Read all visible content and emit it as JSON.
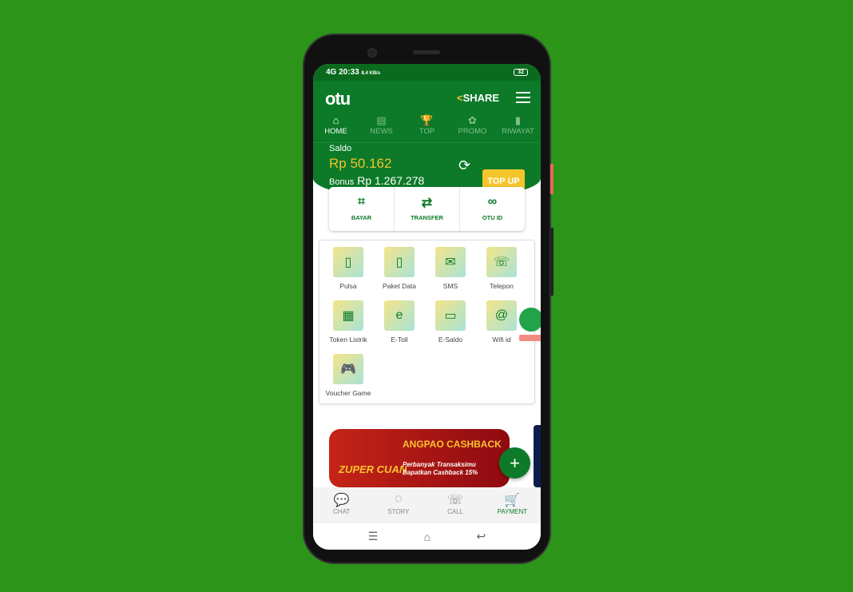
{
  "status": {
    "signal": "4G",
    "time": "20:33",
    "speed": "8.4 KB/s",
    "battery": "32"
  },
  "header": {
    "logo": "otu",
    "share": "SHARE"
  },
  "tabs": [
    {
      "label": "HOME",
      "icon": "⌂"
    },
    {
      "label": "NEWS",
      "icon": "▤"
    },
    {
      "label": "TOP",
      "icon": "🏆"
    },
    {
      "label": "PROMO",
      "icon": "✿"
    },
    {
      "label": "RIWAYAT",
      "icon": "▮"
    }
  ],
  "balance": {
    "saldo_label": "Saldo",
    "amount": "Rp 50.162",
    "bonus_label": "Bonus",
    "bonus": "Rp 1.267.278",
    "topup": "TOP UP"
  },
  "actions": [
    {
      "label": "BAYAR",
      "icon": "⌗"
    },
    {
      "label": "TRANSFER",
      "icon": "⇄"
    },
    {
      "label": "OTU ID",
      "icon": "∞"
    }
  ],
  "services": [
    {
      "label": "Pulsa",
      "icon": "▯"
    },
    {
      "label": "Paket Data",
      "icon": "▯"
    },
    {
      "label": "SMS",
      "icon": "✉"
    },
    {
      "label": "Telepon",
      "icon": "☏"
    },
    {
      "label": "Token Listrik",
      "icon": "▦"
    },
    {
      "label": "E-Toll",
      "icon": "e"
    },
    {
      "label": "E-Saldo",
      "icon": "▭"
    },
    {
      "label": "Wifi id",
      "icon": "@"
    },
    {
      "label": "Voucher Game",
      "icon": "🎮"
    }
  ],
  "banner": {
    "left": "ZUPER CUAN",
    "title": "ANGPAO CASHBACK",
    "sub1": "Perbanyak Transaksimu",
    "sub2": "Dapatkan Cashback 15%"
  },
  "fab": "+",
  "bottom_nav": [
    {
      "label": "CHAT",
      "icon": "💬"
    },
    {
      "label": "STORY",
      "icon": "◌"
    },
    {
      "label": "CALL",
      "icon": "☏"
    },
    {
      "label": "PAYMENT",
      "icon": "🛒"
    }
  ],
  "colors": {
    "brand": "#0c7a28",
    "accent": "#f6c52c",
    "background": "#2b9419"
  }
}
